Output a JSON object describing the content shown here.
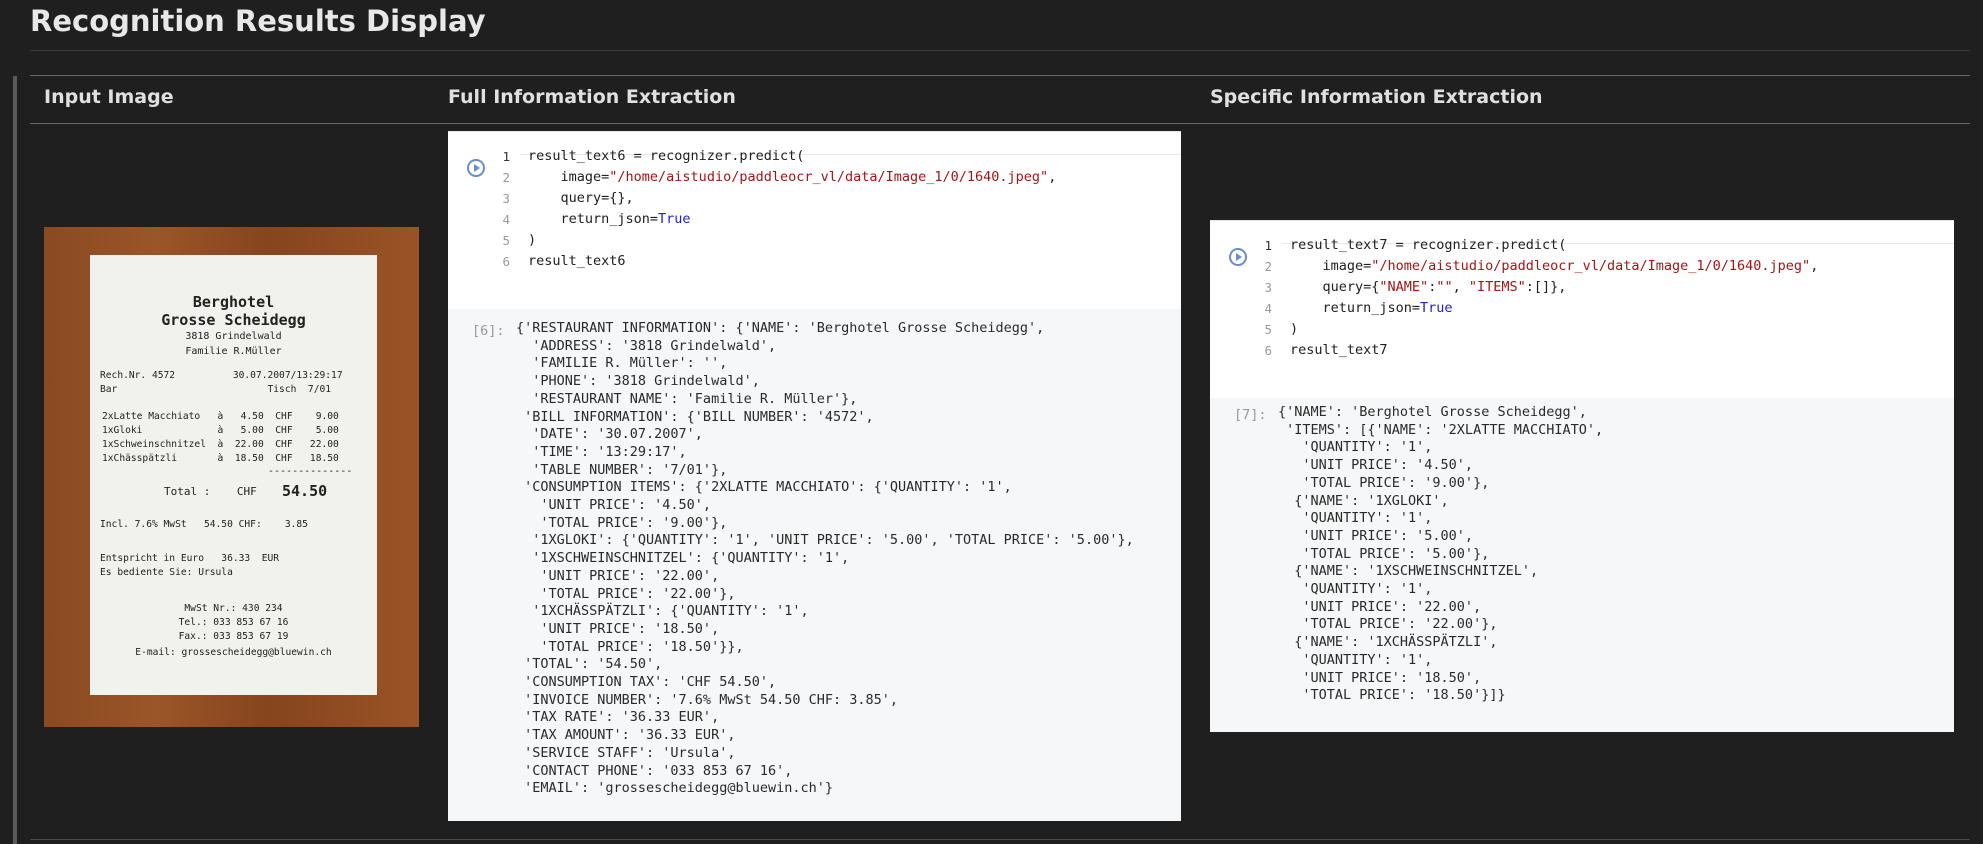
{
  "page": {
    "title": "Recognition Results Display"
  },
  "columns": {
    "input": "Input Image",
    "full": "Full Information Extraction",
    "specific": "Specific Information Extraction"
  },
  "receipt": {
    "lines": [
      "Berghotel",
      "Grosse Scheidegg",
      "3818 Grindelwald",
      "Familie R.Müller",
      "Rech.Nr. 4572          30.07.2007/13:29:17",
      "Bar                          Tisch  7/01",
      "2xLatte Macchiato   à   4.50  CHF    9.00",
      "1xGloki             à   5.00  CHF    5.00",
      "1xSchweinschnitzel  à  22.00  CHF   22.00",
      "1xChässpätzli       à  18.50  CHF   18.50",
      "--------------",
      "Total :    CHF",
      "54.50",
      "Incl. 7.6% MwSt   54.50 CHF:    3.85",
      "Entspricht in Euro   36.33  EUR",
      "Es bediente Sie: Ursula",
      "MwSt Nr.: 430 234",
      "Tel.: 033 853 67 16",
      "Fax.: 033 853 67 19",
      "E-mail: grossescheidegg@bluewin.ch"
    ]
  },
  "cell6": {
    "code": [
      {
        "n": "1",
        "p": [
          "result_text6 = recognizer.predict("
        ]
      },
      {
        "n": "2",
        "p": [
          "    image=",
          {
            "s": "\"/home/aistudio/paddleocr_vl/data/Image_1/0/1640.jpeg\""
          },
          ","
        ]
      },
      {
        "n": "3",
        "p": [
          "    query={},"
        ]
      },
      {
        "n": "4",
        "p": [
          "    return_json=",
          {
            "k": "True"
          }
        ]
      },
      {
        "n": "5",
        "p": [
          ")"
        ]
      },
      {
        "n": "6",
        "p": [
          "result_text6"
        ]
      }
    ],
    "prompt": "[6]:",
    "output": [
      "{'RESTAURANT INFORMATION': {'NAME': 'Berghotel Grosse Scheidegg',",
      "  'ADDRESS': '3818 Grindelwald',",
      "  'FAMILIE R. Müller': '',",
      "  'PHONE': '3818 Grindelwald',",
      "  'RESTAURANT NAME': 'Familie R. Müller'},",
      " 'BILL INFORMATION': {'BILL NUMBER': '4572',",
      "  'DATE': '30.07.2007',",
      "  'TIME': '13:29:17',",
      "  'TABLE NUMBER': '7/01'},",
      " 'CONSUMPTION ITEMS': {'2XLATTE MACCHIATO': {'QUANTITY': '1',",
      "   'UNIT PRICE': '4.50',",
      "   'TOTAL PRICE': '9.00'},",
      "  '1XGLOKI': {'QUANTITY': '1', 'UNIT PRICE': '5.00', 'TOTAL PRICE': '5.00'},",
      "  '1XSCHWEINSCHNITZEL': {'QUANTITY': '1',",
      "   'UNIT PRICE': '22.00',",
      "   'TOTAL PRICE': '22.00'},",
      "  '1XCHÄSSPÄTZLI': {'QUANTITY': '1',",
      "   'UNIT PRICE': '18.50',",
      "   'TOTAL PRICE': '18.50'}},",
      " 'TOTAL': '54.50',",
      " 'CONSUMPTION TAX': 'CHF 54.50',",
      " 'INVOICE NUMBER': '7.6% MwSt 54.50 CHF: 3.85',",
      " 'TAX RATE': '36.33 EUR',",
      " 'TAX AMOUNT': '36.33 EUR',",
      " 'SERVICE STAFF': 'Ursula',",
      " 'CONTACT PHONE': '033 853 67 16',",
      " 'EMAIL': 'grossescheidegg@bluewin.ch'}"
    ]
  },
  "cell7": {
    "code": [
      {
        "n": "1",
        "p": [
          "result_text7 = recognizer.predict("
        ]
      },
      {
        "n": "2",
        "p": [
          "    image=",
          {
            "s": "\"/home/aistudio/paddleocr_vl/data/Image_1/0/1640.jpeg\""
          },
          ","
        ]
      },
      {
        "n": "3",
        "p": [
          "    query={",
          {
            "s": "\"NAME\""
          },
          ":",
          {
            "s": "\"\""
          },
          ", ",
          {
            "s": "\"ITEMS\""
          },
          ":[]},"
        ]
      },
      {
        "n": "4",
        "p": [
          "    return_json=",
          {
            "k": "True"
          }
        ]
      },
      {
        "n": "5",
        "p": [
          ")"
        ]
      },
      {
        "n": "6",
        "p": [
          "result_text7"
        ]
      }
    ],
    "prompt": "[7]:",
    "output": [
      "{'NAME': 'Berghotel Grosse Scheidegg',",
      " 'ITEMS': [{'NAME': '2XLATTE MACCHIATO',",
      "   'QUANTITY': '1',",
      "   'UNIT PRICE': '4.50',",
      "   'TOTAL PRICE': '9.00'},",
      "  {'NAME': '1XGLOKI',",
      "   'QUANTITY': '1',",
      "   'UNIT PRICE': '5.00',",
      "   'TOTAL PRICE': '5.00'},",
      "  {'NAME': '1XSCHWEINSCHNITZEL',",
      "   'QUANTITY': '1',",
      "   'UNIT PRICE': '22.00',",
      "   'TOTAL PRICE': '22.00'},",
      "  {'NAME': '1XCHÄSSPÄTZLI',",
      "   'QUANTITY': '1',",
      "   'UNIT PRICE': '18.50',",
      "   'TOTAL PRICE': '18.50'}]}"
    ]
  }
}
